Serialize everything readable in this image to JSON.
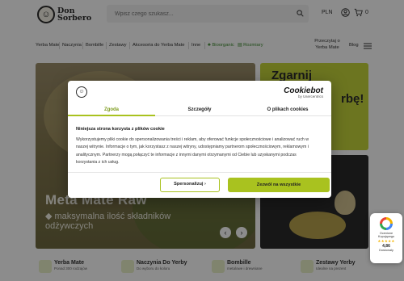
{
  "header": {
    "logo_line1": "Don",
    "logo_line2": "Sorbero",
    "search_placeholder": "Wpisz czego szukasz...",
    "language": "PLN",
    "cart_total": "0"
  },
  "nav": {
    "items": [
      "Yerba Mate",
      "Naczynia",
      "Bombille",
      "Zestawy",
      "Akcesoria do Yerba Mate",
      "Inne"
    ],
    "green_items": [
      "Bioorganic",
      "Rozmiary"
    ],
    "right_items": [
      "Przeczytaj o Yerba Mate",
      "Blog"
    ]
  },
  "hero": {
    "title": "Meta Mate Raw",
    "subtitle": "◆ maksymalna ilość składników odżywczych",
    "prev_label": "‹",
    "next_label": "›"
  },
  "promo_top": {
    "line1": "Zgarnij",
    "line2": "rbę!"
  },
  "cookie": {
    "brand_name": "Cookiebot",
    "brand_by": "by Usercentrics",
    "tabs": [
      "Zgoda",
      "Szczegóły",
      "O plikach cookies"
    ],
    "active_tab": "Zgoda",
    "heading": "Niniejsza strona korzysta z plików cookie",
    "body": "Wykorzystujemy pliki cookie do spersonalizowania treści i reklam, aby oferować funkcje społecznościowe i analizować ruch w naszej witrynie. Informacje o tym, jak korzystasz z naszej witryny, udostępniamy partnerom społecznościowym, reklamowym i analitycznym. Partnerzy mogą połączyć te informacje z innymi danymi otrzymanymi od Ciebie lub uzyskanymi podczas korzystania z ich usług.",
    "btn_customize": "Spersonalizuj  ›",
    "btn_allow_all": "Zezwól na wszystkie"
  },
  "rating": {
    "line1": "Ocenione",
    "line2": "Kupującego",
    "stars": "★★★★★",
    "score": "4,86",
    "line3": "Doskonały"
  },
  "categories": [
    {
      "title": "Yerba Mate",
      "sub": "Ponad 300 rodzajów"
    },
    {
      "title": "Naczynia Do Yerby",
      "sub": "Do wyboru do koloru"
    },
    {
      "title": "Bombille",
      "sub": "metalowe i drewniane"
    },
    {
      "title": "Zestawy Yerby",
      "sub": "Idealne na prezent"
    }
  ],
  "colors": {
    "accent": "#a9c21f",
    "promo_yellow": "#c5d63b",
    "text_dark": "#141414"
  }
}
